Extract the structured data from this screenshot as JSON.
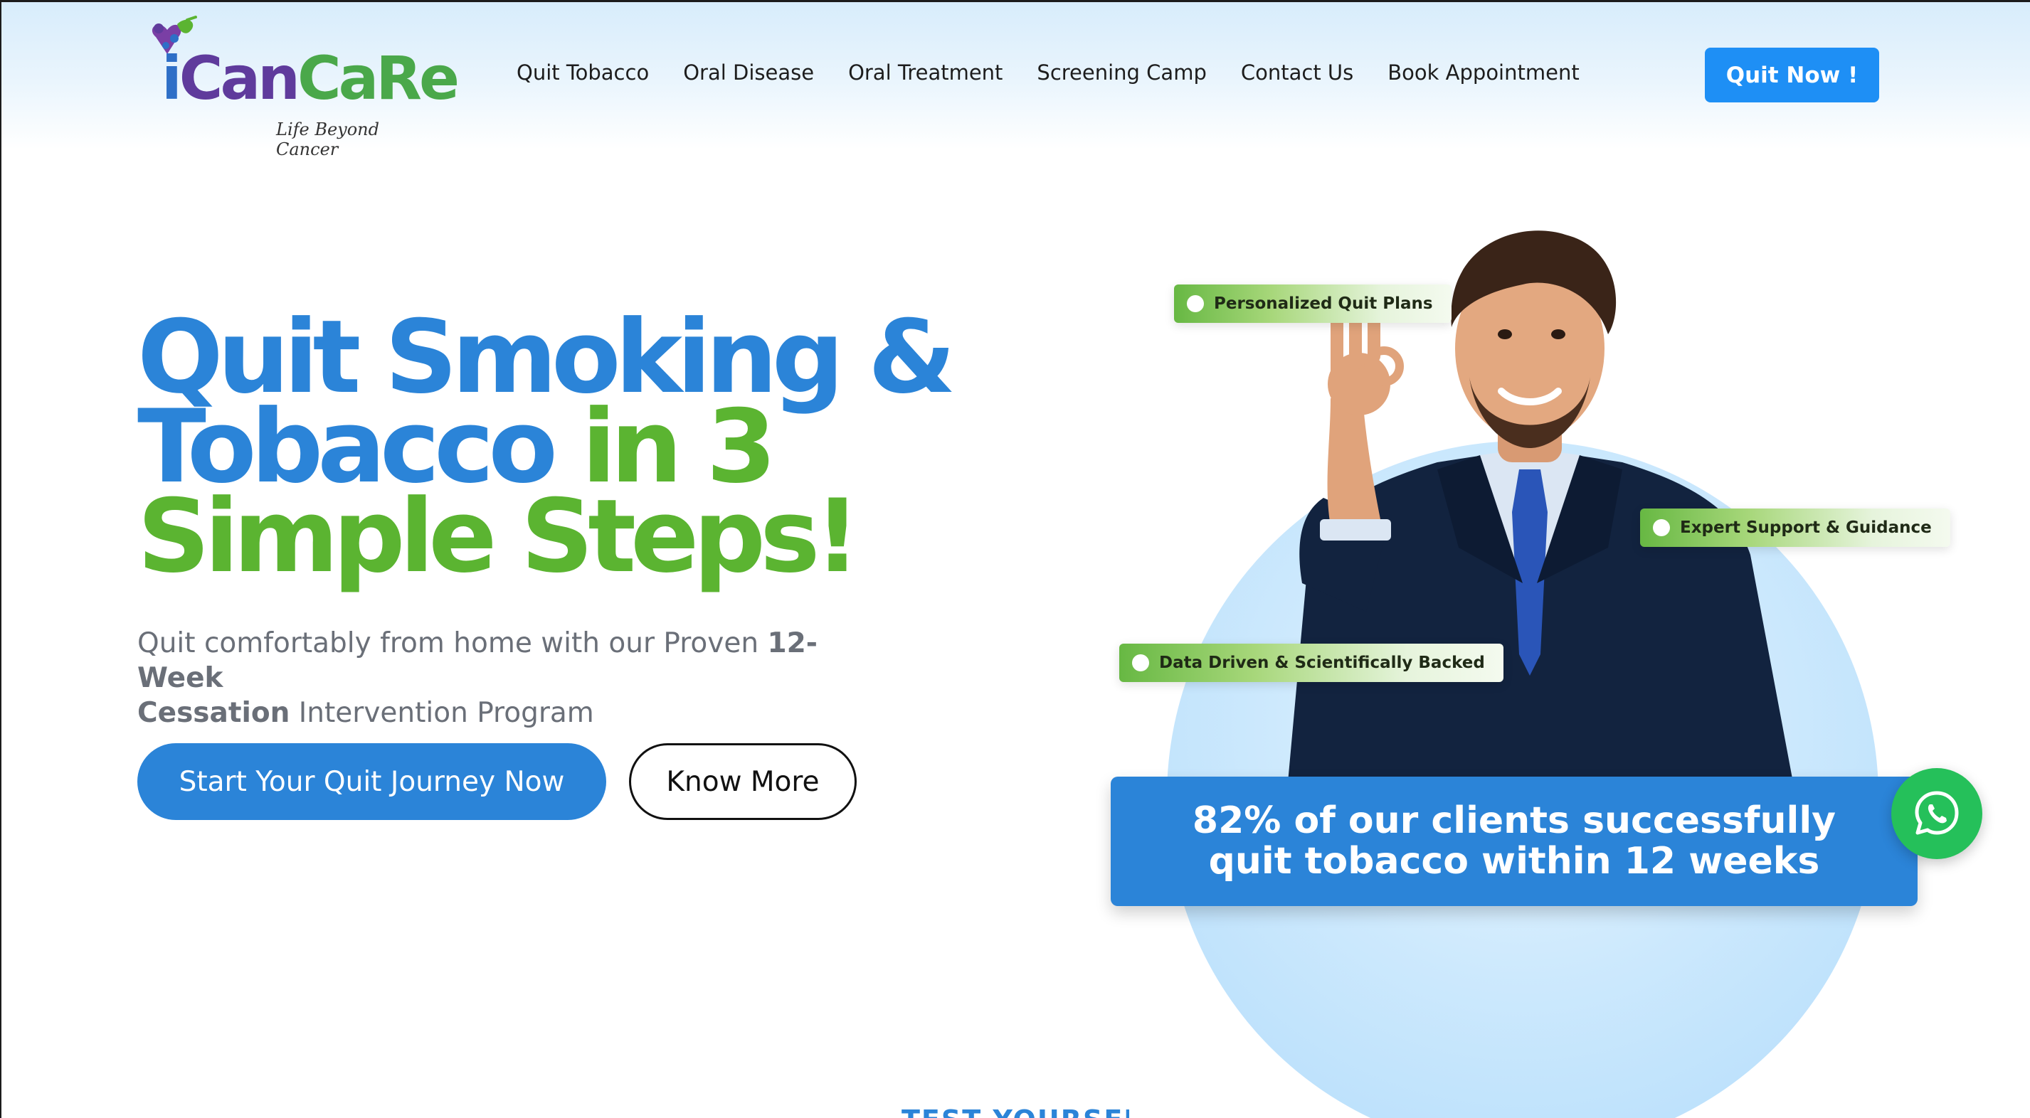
{
  "brand": {
    "name_parts": [
      "i",
      "Can",
      "CaRe"
    ],
    "tagline": "Life Beyond Cancer",
    "logo_icon": "ribbon-people-icon"
  },
  "nav": {
    "items": [
      {
        "label": "Quit Tobacco"
      },
      {
        "label": "Oral Disease"
      },
      {
        "label": "Oral Treatment"
      },
      {
        "label": "Screening Camp"
      },
      {
        "label": "Contact Us"
      },
      {
        "label": "Book Appointment"
      }
    ],
    "cta_label": "Quit Now !"
  },
  "hero": {
    "title_line1": "Quit Smoking &",
    "title_line2_blue": "Tobacco",
    "title_line2_green": "in 3",
    "title_line3": "Simple Steps!",
    "subtitle_pre": "Quit comfortably from home with our Proven ",
    "subtitle_bold1": "12-Week",
    "subtitle_bold2": "Cessation",
    "subtitle_post": " Intervention Program",
    "primary_cta": "Start Your Quit Journey Now",
    "secondary_cta": "Know More"
  },
  "features": [
    {
      "label": "Personalized Quit Plans"
    },
    {
      "label": "Expert Support & Guidance"
    },
    {
      "label": "Data Driven & Scientifically Backed"
    }
  ],
  "stat": {
    "line1": "82% of our clients successfully",
    "line2": "quit tobacco within 12 weeks"
  },
  "whatsapp": {
    "icon": "whatsapp-icon"
  },
  "next_section": {
    "heading": "TEST YOURSELF"
  },
  "colors": {
    "primary_blue": "#2b84d8",
    "button_blue": "#1e8ff5",
    "accent_green": "#5bb431",
    "whatsapp_green": "#25c05a"
  }
}
